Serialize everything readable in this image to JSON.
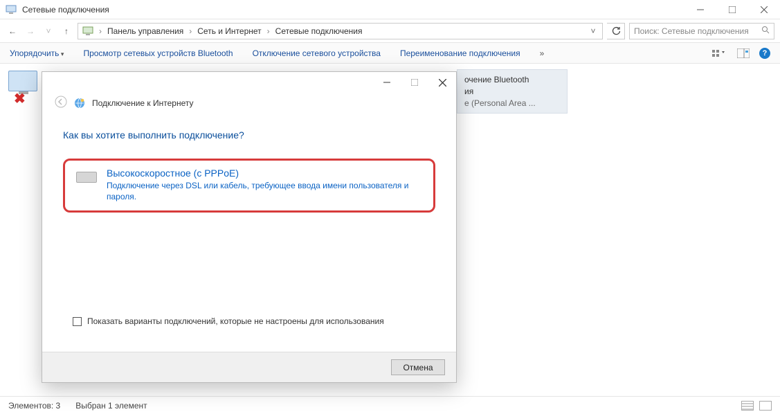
{
  "window": {
    "title": "Сетевые подключения"
  },
  "breadcrumb": {
    "root": "Панель управления",
    "mid": "Сеть и Интернет",
    "leaf": "Сетевые подключения"
  },
  "search": {
    "placeholder": "Поиск: Сетевые подключения"
  },
  "toolbar": {
    "organize": "Упорядочить",
    "bt_devices": "Просмотр сетевых устройств Bluetooth",
    "disable": "Отключение сетевого устройства",
    "rename": "Переименование подключения",
    "more": "»"
  },
  "bt_item": {
    "line1": "очение Bluetooth",
    "line2": "ия",
    "line3": "e (Personal Area ..."
  },
  "status": {
    "count": "Элементов: 3",
    "selected": "Выбран 1 элемент"
  },
  "dialog": {
    "header": "Подключение к Интернету",
    "question": "Как вы хотите выполнить подключение?",
    "option_title": "Высокоскоростное (с PPPoE)",
    "option_desc": "Подключение через DSL или кабель, требующее ввода имени пользователя и пароля.",
    "show_unconfigured": "Показать варианты подключений, которые не настроены для использования",
    "cancel": "Отмена"
  }
}
